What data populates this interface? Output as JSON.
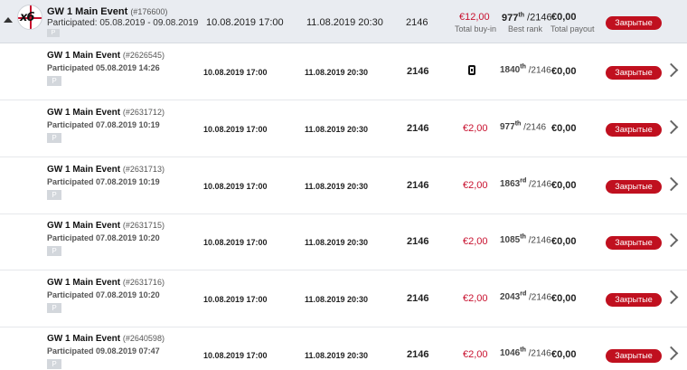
{
  "group": {
    "multiplier": "x6",
    "title": "GW 1 Main Event",
    "id": "(#176600)",
    "participated": "Participated: 05.08.2019 - 09.08.2019",
    "tag": "P",
    "start": "10.08.2019 17:00",
    "end": "11.08.2019 20:30",
    "players": "2146",
    "buyin": "€12,00",
    "buyin_label": "Total buy-in",
    "rank": "977",
    "rank_suffix": "th",
    "rank_total": "/2146",
    "rank_label": "Best rank",
    "payout": "€0,00",
    "payout_label": "Total payout",
    "status": "Закрытые"
  },
  "rows": [
    {
      "title": "GW 1 Main Event",
      "id": "(#2626545)",
      "participated": "Participated 05.08.2019 14:26",
      "tag": "P",
      "start": "10.08.2019 17:00",
      "end": "11.08.2019 20:30",
      "players": "2146",
      "buyin": "",
      "ticket_icon": "ticket-icon",
      "rank": "1840",
      "rank_suffix": "th",
      "rank_total": "/2146",
      "payout": "€0,00",
      "status": "Закрытые"
    },
    {
      "title": "GW 1 Main Event",
      "id": "(#2631712)",
      "participated": "Participated 07.08.2019 10:19",
      "tag": "P",
      "start": "10.08.2019 17:00",
      "end": "11.08.2019 20:30",
      "players": "2146",
      "buyin": "€2,00",
      "rank": "977",
      "rank_suffix": "th",
      "rank_total": "/2146",
      "payout": "€0,00",
      "status": "Закрытые"
    },
    {
      "title": "GW 1 Main Event",
      "id": "(#2631713)",
      "participated": "Participated 07.08.2019 10:19",
      "tag": "P",
      "start": "10.08.2019 17:00",
      "end": "11.08.2019 20:30",
      "players": "2146",
      "buyin": "€2,00",
      "rank": "1863",
      "rank_suffix": "rd",
      "rank_total": "/2146",
      "payout": "€0,00",
      "status": "Закрытые"
    },
    {
      "title": "GW 1 Main Event",
      "id": "(#2631715)",
      "participated": "Participated 07.08.2019 10:20",
      "tag": "P",
      "start": "10.08.2019 17:00",
      "end": "11.08.2019 20:30",
      "players": "2146",
      "buyin": "€2,00",
      "rank": "1085",
      "rank_suffix": "th",
      "rank_total": "/2146",
      "payout": "€0,00",
      "status": "Закрытые"
    },
    {
      "title": "GW 1 Main Event",
      "id": "(#2631716)",
      "participated": "Participated 07.08.2019 10:20",
      "tag": "P",
      "start": "10.08.2019 17:00",
      "end": "11.08.2019 20:30",
      "players": "2146",
      "buyin": "€2,00",
      "rank": "2043",
      "rank_suffix": "rd",
      "rank_total": "/2146",
      "payout": "€0,00",
      "status": "Закрытые"
    },
    {
      "title": "GW 1 Main Event",
      "id": "(#2640598)",
      "participated": "Participated 09.08.2019 07:47",
      "tag": "P",
      "start": "10.08.2019 17:00",
      "end": "11.08.2019 20:30",
      "players": "2146",
      "buyin": "€2,00",
      "rank": "1046",
      "rank_suffix": "th",
      "rank_total": "/2146",
      "payout": "€0,00",
      "status": "Закрытые"
    }
  ]
}
